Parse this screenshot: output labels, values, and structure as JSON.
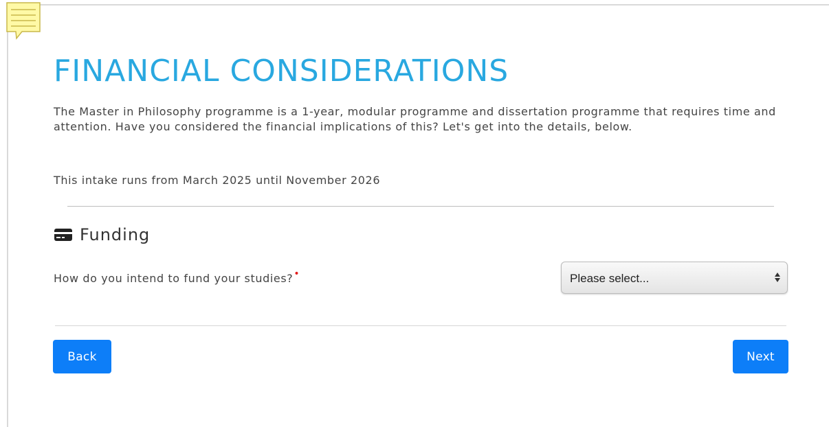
{
  "page": {
    "title": "FINANCIAL CONSIDERATIONS",
    "intro": "The Master in Philosophy programme is a 1-year, modular programme and dissertation programme that requires time and attention. Have you considered the financial implications of this? Let's get into the details, below.",
    "intake": "This intake runs from March 2025 until November 2026"
  },
  "funding": {
    "icon": "credit-card-icon",
    "heading": "Funding",
    "question": "How do you intend to fund your studies?",
    "required_marker": "•",
    "select": {
      "selected": "Please select..."
    }
  },
  "nav": {
    "back_label": "Back",
    "next_label": "Next"
  },
  "colors": {
    "title": "#29a8e0",
    "button": "#0d7ef8",
    "required": "#e31b1b",
    "note": "#fff9a6"
  }
}
